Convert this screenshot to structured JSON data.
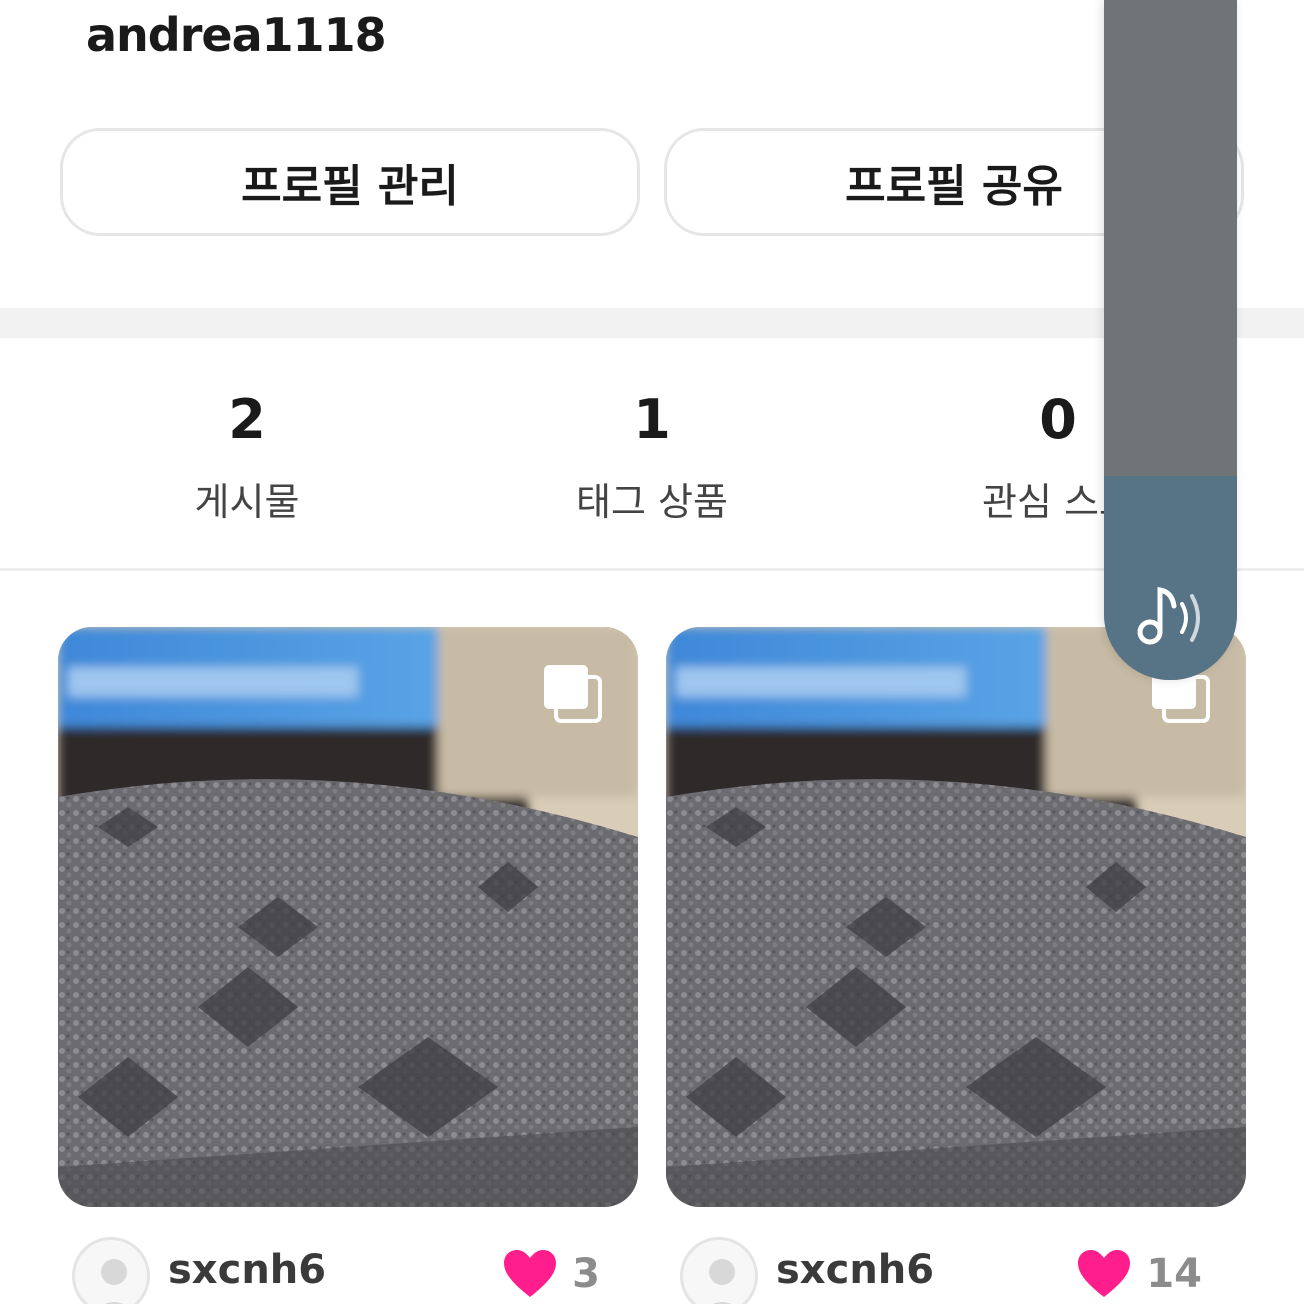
{
  "profile": {
    "username": "andrea1118",
    "manage_button": "프로필 관리",
    "share_button": "프로필 공유"
  },
  "stats": [
    {
      "value": "2",
      "label": "게시물"
    },
    {
      "value": "1",
      "label": "태그 상품"
    },
    {
      "value": "0",
      "label": "관심 스토"
    }
  ],
  "posts": [
    {
      "author": "sxcnh6",
      "likes": "3"
    },
    {
      "author": "sxcnh6",
      "likes": "14"
    }
  ],
  "music_volume": {
    "level_fraction": 0.3,
    "icon": "music-volume-icon"
  },
  "colors": {
    "heart": "#ff1e8c",
    "accent_panel": "#577386",
    "panel_bg": "#6f7477"
  }
}
